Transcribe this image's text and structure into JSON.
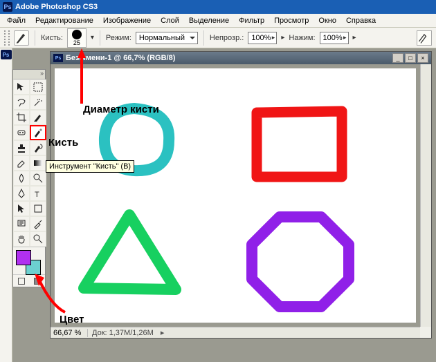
{
  "app": {
    "title": "Adobe Photoshop CS3",
    "logo_text": "Ps"
  },
  "menu": [
    "Файл",
    "Редактирование",
    "Изображение",
    "Слой",
    "Выделение",
    "Фильтр",
    "Просмотр",
    "Окно",
    "Справка"
  ],
  "options": {
    "brush_label": "Кисть:",
    "brush_size": "25",
    "mode_label": "Режим:",
    "mode_value": "Нормальный",
    "opacity_label": "Непрозр.:",
    "opacity_value": "100%",
    "flow_label": "Нажим:",
    "flow_value": "100%"
  },
  "doc": {
    "title": "Безымени-1 @ 66,7% (RGB/8)",
    "zoom": "66,67 %",
    "docsize": "Док: 1,37M/1,26M"
  },
  "tooltip": "Инструмент \"Кисть\" (B)",
  "annot": {
    "diameter": "Диаметр кисти",
    "brush": "Кисть",
    "color": "Цвет"
  },
  "tools": {
    "row0": [
      "move",
      "marquee"
    ],
    "row1": [
      "lasso",
      "wand"
    ],
    "row2": [
      "crop",
      "slice"
    ],
    "row3": [
      "heal",
      "brush"
    ],
    "row4": [
      "stamp",
      "history"
    ],
    "row5": [
      "eraser",
      "gradient"
    ],
    "row6": [
      "blur",
      "dodge"
    ],
    "row7": [
      "pen",
      "type"
    ],
    "row8": [
      "path",
      "shape"
    ],
    "row9": [
      "notes",
      "eyedrop"
    ],
    "row10": [
      "hand",
      "zoom"
    ]
  },
  "colors": {
    "fg": "#b030f0",
    "bg": "#6cd0d0",
    "shapes": {
      "circle": "#2bc1c1",
      "square": "#f01515",
      "triangle": "#17d060",
      "octagon": "#9020e8"
    }
  }
}
